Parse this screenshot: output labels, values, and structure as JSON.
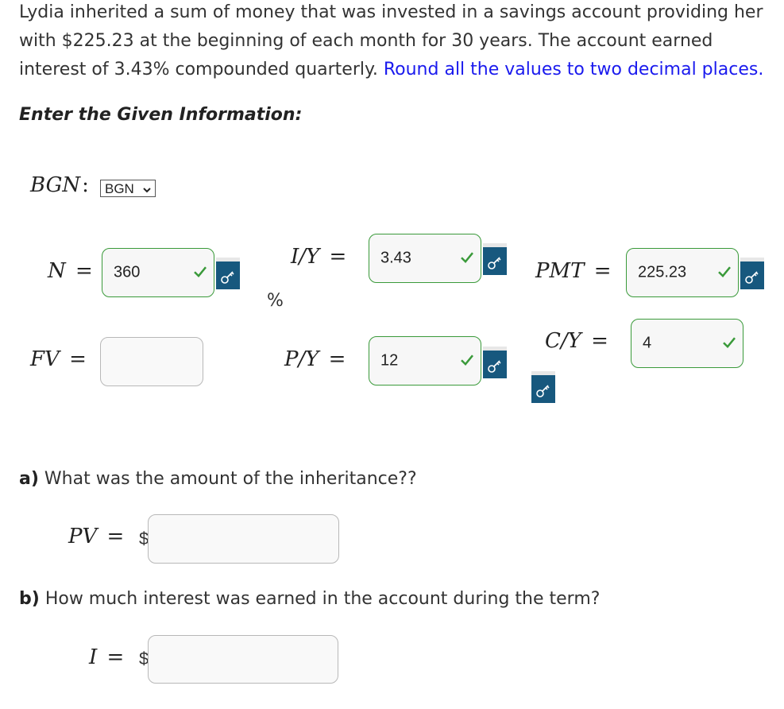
{
  "problem": {
    "text": "Lydia inherited a sum of money that was invested in a savings account providing her with $225.23 at the beginning of each month for 30 years. The account earned interest of 3.43% compounded quarterly.",
    "round_note": "Round all the values to two decimal places."
  },
  "given_title": "Enter the Given Information:",
  "bgn": {
    "label": "BGN",
    "selected": "BGN"
  },
  "fields": {
    "n": {
      "label": "N",
      "value": "360"
    },
    "iy": {
      "label": "I/Y",
      "value": "3.43",
      "unit": "%"
    },
    "pmt": {
      "label": "PMT",
      "value": "225.23"
    },
    "fv": {
      "label": "FV",
      "value": ""
    },
    "py": {
      "label": "P/Y",
      "value": "12"
    },
    "cy": {
      "label": "C/Y",
      "value": "4"
    }
  },
  "question_a": {
    "letter": "a)",
    "text": "What was the amount of the inheritance??",
    "label": "PV",
    "currency": "$",
    "value": ""
  },
  "question_b": {
    "letter": "b)",
    "text": "How much interest was earned in the account during the term?",
    "label": "I",
    "currency": "$",
    "value": ""
  },
  "colors": {
    "accent_link": "#1a1aee",
    "correct_border": "#3a9a3a",
    "key_button": "#17587e"
  },
  "icons": {
    "check": "check-icon",
    "key": "key-icon",
    "dropdown": "chevron-down-icon"
  }
}
